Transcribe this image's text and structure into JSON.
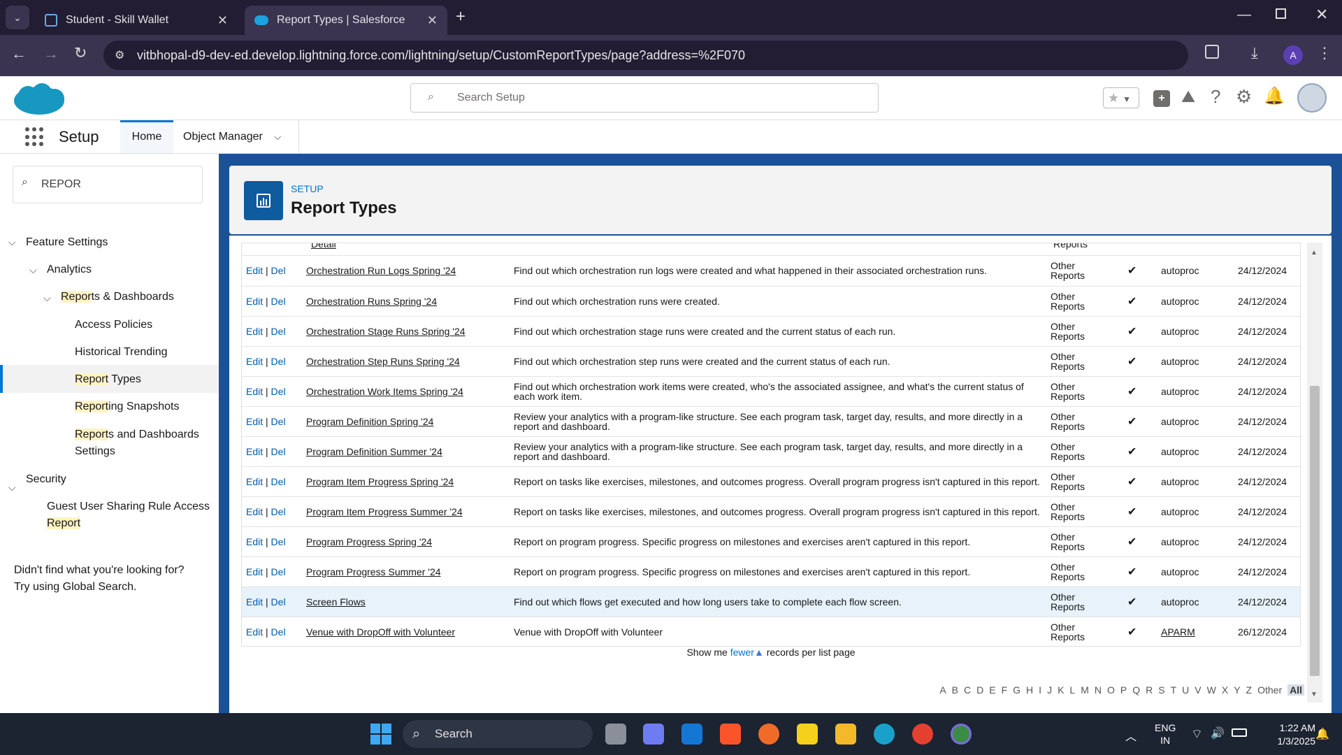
{
  "browser": {
    "tabs": [
      {
        "title": "Student - Skill Wallet"
      },
      {
        "title": "Report Types | Salesforce"
      }
    ],
    "url": "vitbhopal-d9-dev-ed.develop.lightning.force.com/lightning/setup/CustomReportTypes/page?address=%2F070",
    "profile_initial": "A"
  },
  "sf": {
    "search_placeholder": "Search Setup",
    "app_name": "Setup",
    "nav_tabs": [
      "Home",
      "Object Manager"
    ]
  },
  "sidebar": {
    "quick_find": "REPOR",
    "tree": {
      "feature_settings": "Feature Settings",
      "analytics": "Analytics",
      "reports_dashboards_hl": "Repor",
      "reports_dashboards_rest": "ts & Dashboards",
      "access_policies": "Access Policies",
      "historical_trending": "Historical Trending",
      "report_types_hl": "Report",
      "report_types_rest": " Types",
      "reporting_snapshots_hl": "Report",
      "reporting_snapshots_rest": "ing Snapshots",
      "rd_settings_hl": "Report",
      "rd_settings_rest": "s and Dashboards",
      "rd_settings_line2": "Settings",
      "security": "Security",
      "guest_line1": "Guest User Sharing Rule Access",
      "guest_line2_hl": "Report"
    },
    "help_line1": "Didn't find what you're looking for?",
    "help_line2": "Try using Global Search."
  },
  "page": {
    "eyebrow": "SETUP",
    "title": "Report Types"
  },
  "table": {
    "partial_name": "Detail",
    "partial_category": "Reports",
    "edit": "Edit",
    "sep": "|",
    "del": "Del",
    "rows": [
      {
        "name": "Orchestration Run Logs Spring '24",
        "desc": "Find out which orchestration run logs were created and what happened in their associated orchestration runs.",
        "cat1": "Other",
        "cat2": "Reports",
        "check": "✔",
        "by": "autoproc",
        "date": "24/12/2024"
      },
      {
        "name": "Orchestration Runs Spring '24",
        "desc": "Find out which orchestration runs were created.",
        "cat1": "Other",
        "cat2": "Reports",
        "check": "✔",
        "by": "autoproc",
        "date": "24/12/2024"
      },
      {
        "name": "Orchestration Stage Runs Spring '24",
        "desc": "Find out which orchestration stage runs were created and the current status of each run.",
        "cat1": "Other",
        "cat2": "Reports",
        "check": "✔",
        "by": "autoproc",
        "date": "24/12/2024"
      },
      {
        "name": "Orchestration Step Runs Spring '24",
        "desc": "Find out which orchestration step runs were created and the current status of each run.",
        "cat1": "Other",
        "cat2": "Reports",
        "check": "✔",
        "by": "autoproc",
        "date": "24/12/2024"
      },
      {
        "name": "Orchestration Work Items Spring '24",
        "desc": "Find out which orchestration work items were created, who's the associated assignee, and what's the current status of each work item.",
        "cat1": "Other",
        "cat2": "Reports",
        "check": "✔",
        "by": "autoproc",
        "date": "24/12/2024"
      },
      {
        "name": "Program Definition Spring '24",
        "desc": "Review your analytics with a program-like structure. See each program task, target day, results, and more directly in a report and dashboard.",
        "cat1": "Other",
        "cat2": "Reports",
        "check": "✔",
        "by": "autoproc",
        "date": "24/12/2024"
      },
      {
        "name": "Program Definition Summer '24",
        "desc": "Review your analytics with a program-like structure. See each program task, target day, results, and more directly in a report and dashboard.",
        "cat1": "Other",
        "cat2": "Reports",
        "check": "✔",
        "by": "autoproc",
        "date": "24/12/2024"
      },
      {
        "name": "Program Item Progress Spring '24",
        "desc": "Report on tasks like exercises, milestones, and outcomes progress. Overall program progress isn't captured in this report.",
        "cat1": "Other",
        "cat2": "Reports",
        "check": "✔",
        "by": "autoproc",
        "date": "24/12/2024"
      },
      {
        "name": "Program Item Progress Summer '24",
        "desc": "Report on tasks like exercises, milestones, and outcomes progress. Overall program progress isn't captured in this report.",
        "cat1": "Other",
        "cat2": "Reports",
        "check": "✔",
        "by": "autoproc",
        "date": "24/12/2024"
      },
      {
        "name": "Program Progress Spring '24",
        "desc": "Report on program progress. Specific progress on milestones and exercises aren't captured in this report.",
        "cat1": "Other",
        "cat2": "Reports",
        "check": "✔",
        "by": "autoproc",
        "date": "24/12/2024"
      },
      {
        "name": "Program Progress Summer '24",
        "desc": "Report on program progress. Specific progress on milestones and exercises aren't captured in this report.",
        "cat1": "Other",
        "cat2": "Reports",
        "check": "✔",
        "by": "autoproc",
        "date": "24/12/2024"
      },
      {
        "name": "Screen Flows",
        "desc": "Find out which flows get executed and how long users take to complete each flow screen.",
        "cat1": "Other",
        "cat2": "Reports",
        "check": "✔",
        "by": "autoproc",
        "date": "24/12/2024"
      },
      {
        "name": "Venue with DropOff with Volunteer",
        "desc": "Venue with DropOff with Volunteer",
        "cat1": "Other",
        "cat2": "Reports",
        "check": "✔",
        "by": "APARM",
        "date": "26/12/2024"
      }
    ],
    "show_me": "Show me",
    "fewer": "fewer",
    "per_page": "records per list page",
    "alphabet": [
      "A",
      "B",
      "C",
      "D",
      "E",
      "F",
      "G",
      "H",
      "I",
      "J",
      "K",
      "L",
      "M",
      "N",
      "O",
      "P",
      "Q",
      "R",
      "S",
      "T",
      "U",
      "V",
      "W",
      "X",
      "Y",
      "Z",
      "Other",
      "All"
    ]
  },
  "taskbar": {
    "search": "Search",
    "lang1": "ENG",
    "lang2": "IN",
    "time": "1:22 AM",
    "date": "1/3/2025"
  }
}
